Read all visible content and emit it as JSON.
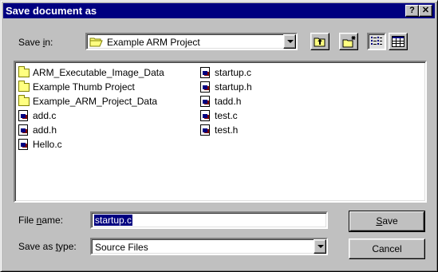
{
  "dialog": {
    "title": "Save document as",
    "help_glyph": "?",
    "close_glyph": "✕"
  },
  "save_in": {
    "label_pre": "Save ",
    "label_mnemonic": "i",
    "label_post": "n:",
    "value": "Example ARM Project",
    "icon": "open-folder-icon"
  },
  "toolbar": {
    "up_one_level_icon": "up-folder-icon",
    "new_folder_icon": "new-folder-icon",
    "list_view_icon": "list-view-icon",
    "details_view_icon": "details-view-icon"
  },
  "files": {
    "column1": [
      {
        "name": "ARM_Executable_Image_Data",
        "type": "folder"
      },
      {
        "name": "Example Thumb Project",
        "type": "folder"
      },
      {
        "name": "Example_ARM_Project_Data",
        "type": "folder"
      },
      {
        "name": "add.c",
        "type": "file"
      },
      {
        "name": "add.h",
        "type": "file"
      },
      {
        "name": "Hello.c",
        "type": "file"
      }
    ],
    "column2": [
      {
        "name": "startup.c",
        "type": "file"
      },
      {
        "name": "startup.h",
        "type": "file"
      },
      {
        "name": "tadd.h",
        "type": "file"
      },
      {
        "name": "test.c",
        "type": "file"
      },
      {
        "name": "test.h",
        "type": "file"
      }
    ]
  },
  "file_name": {
    "label_pre": "File ",
    "label_mnemonic": "n",
    "label_post": "ame:",
    "value": "startup.c"
  },
  "save_as_type": {
    "label_pre": "Save as ",
    "label_mnemonic": "t",
    "label_post": "ype:",
    "value": "Source Files"
  },
  "buttons": {
    "save_mnemonic": "S",
    "save_rest": "ave",
    "cancel": "Cancel"
  }
}
